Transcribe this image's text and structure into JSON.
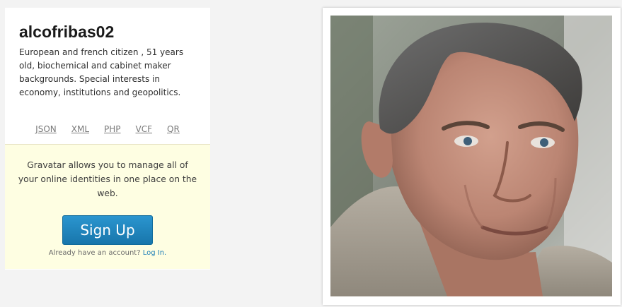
{
  "profile": {
    "username": "alcofribas02",
    "bio": "European and french citizen , 51 years old, biochemical and cabinet maker backgrounds. Special interests in economy, institutions and geopolitics.",
    "links": [
      "JSON",
      "XML",
      "PHP",
      "VCF",
      "QR"
    ]
  },
  "signup": {
    "pitch": "Gravatar allows you to manage all of your online identities in one place on the web.",
    "button_label": "Sign Up",
    "login_prompt": "Already have an account?",
    "login_link": "Log In."
  },
  "colors": {
    "page_background": "#f3f3f3",
    "signup_panel": "#fefee2",
    "button_blue": "#1f82bb",
    "link_blue": "#1e7fb8"
  }
}
